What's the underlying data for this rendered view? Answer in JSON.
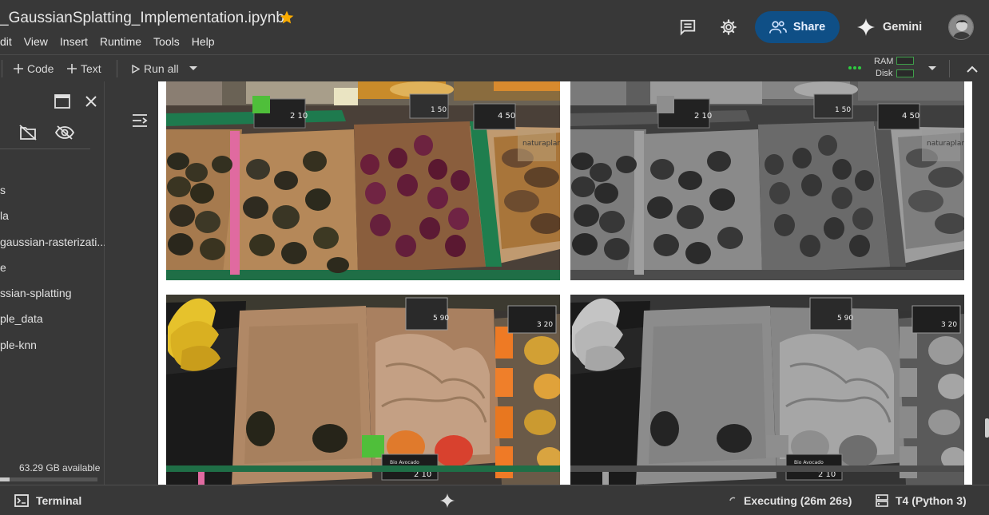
{
  "notebook": {
    "title": "_GaussianSplatting_Implementation.ipynb",
    "starred": true,
    "star_color": "#f9ab00"
  },
  "menu": [
    "dit",
    "View",
    "Insert",
    "Runtime",
    "Tools",
    "Help"
  ],
  "header": {
    "comments_icon": "comment-icon",
    "settings_icon": "gear-icon",
    "share_label": "Share",
    "share_color": "#0f4f86",
    "gemini_label": "Gemini"
  },
  "toolbar": {
    "code_label": "Code",
    "text_label": "Text",
    "run_all_label": "Run all",
    "ram_label": "RAM",
    "disk_label": "Disk",
    "resource_ok_color": "#2ecc40"
  },
  "files": {
    "items": [
      "s",
      "la",
      "gaussian-rasterizati...",
      "e",
      "ssian-splatting",
      "ple_data",
      "ple-knn"
    ],
    "disk_available": "63.29 GB available",
    "disk_used_fraction": 0.1
  },
  "output_images": [
    {
      "name": "market-avocados-color",
      "mode": "color"
    },
    {
      "name": "market-avocados-grayscale",
      "mode": "grayscale"
    },
    {
      "name": "market-empty-box-color",
      "mode": "color"
    },
    {
      "name": "market-empty-box-grayscale",
      "mode": "grayscale"
    }
  ],
  "price_tags": {
    "tag_a": "2 10",
    "tag_b": "1 50",
    "tag_c": "4 50",
    "tag_d": "5 90",
    "tag_e": "3 20",
    "tag_f": "2 10",
    "bio_label": "Bio Avocado"
  },
  "status": {
    "terminal_label": "Terminal",
    "executing": "Executing (26m 26s)",
    "runtime": "T4 (Python 3)"
  }
}
